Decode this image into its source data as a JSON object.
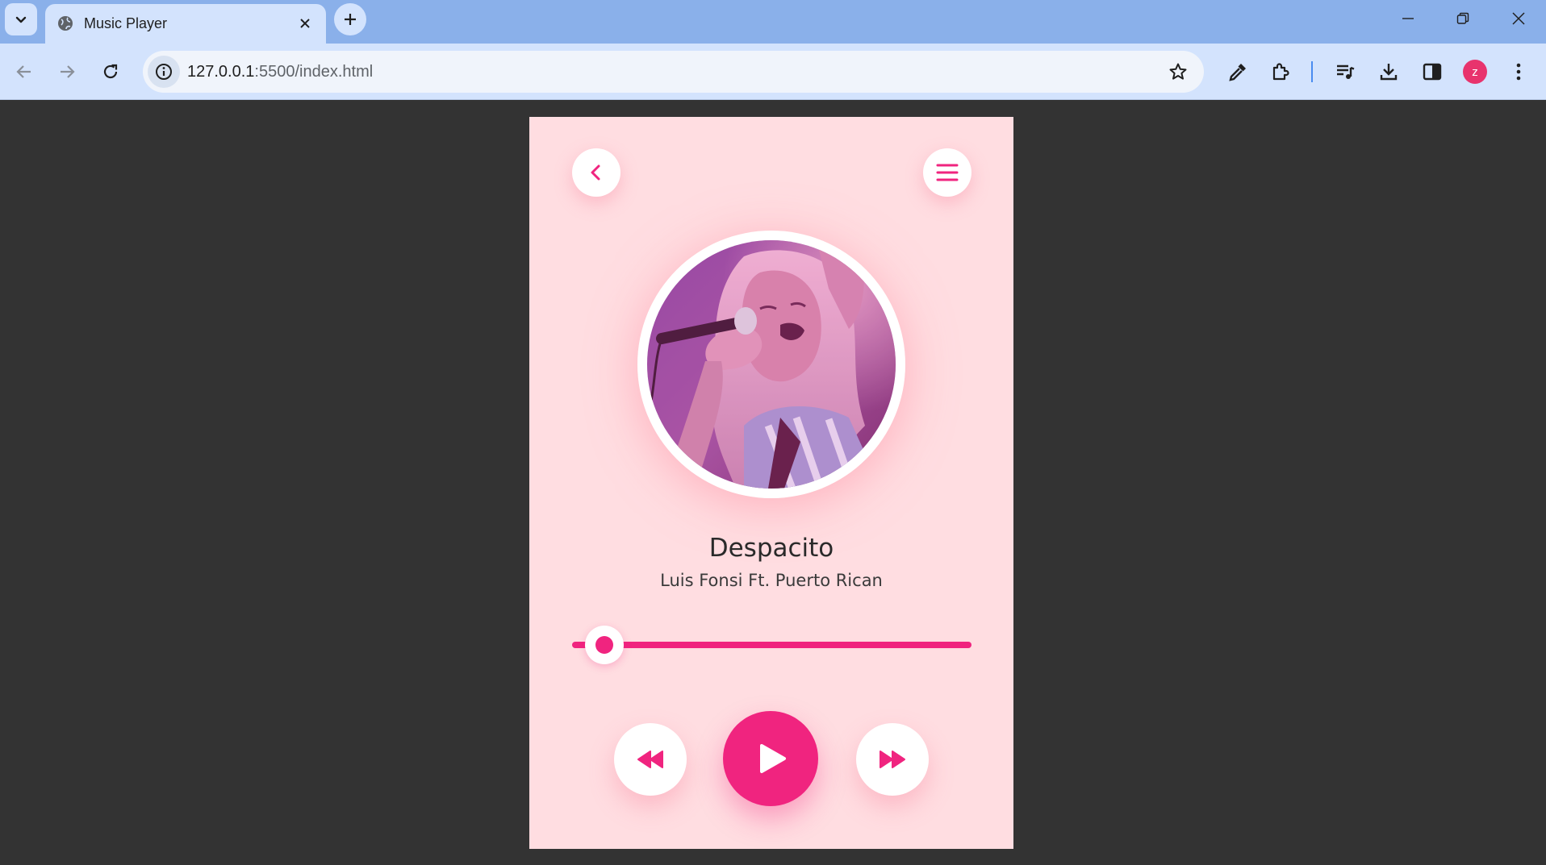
{
  "browser": {
    "tab_title": "Music Player",
    "url_host": "127.0.0.1",
    "url_path": ":5500/index.html",
    "profile_initial": "z",
    "icons": [
      "tab-search-icon",
      "globe-icon",
      "close-icon",
      "plus-icon",
      "minimize-icon",
      "restore-icon",
      "window-close-icon",
      "back-arrow-icon",
      "forward-arrow-icon",
      "reload-icon",
      "site-info-icon",
      "star-icon",
      "eyedropper-icon",
      "extensions-icon",
      "media-queue-icon",
      "download-icon",
      "side-panel-icon",
      "more-vert-icon"
    ]
  },
  "player": {
    "song_title": "Despacito",
    "artist": "Luis Fonsi Ft. Puerto Rican",
    "progress_fraction": 0.08,
    "accent_color": "#f0247f",
    "card_background": "#ffdde1",
    "icons": [
      "chevron-left-icon",
      "hamburger-menu-icon",
      "rewind-icon",
      "play-icon",
      "fast-forward-icon"
    ]
  }
}
